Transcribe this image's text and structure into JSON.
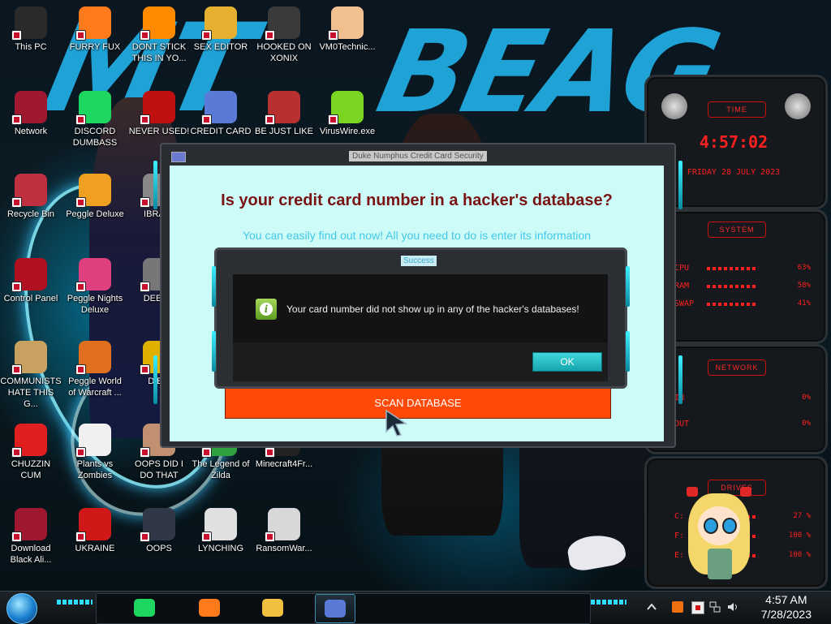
{
  "desktop": {
    "icons": [
      {
        "label": "This PC",
        "icon": "computer-icon",
        "color": "#2a2a2a"
      },
      {
        "label": "FURRY FUX",
        "icon": "firefox-icon",
        "color": "#ff7a1a"
      },
      {
        "label": "DONT STICK\nTHIS IN YO...",
        "icon": "vlc-cone-icon",
        "color": "#ff8a00"
      },
      {
        "label": "SEX EDITOR",
        "icon": "hxd-icon",
        "color": "#e8b030"
      },
      {
        "label": "HOOKED ON\nXONIX",
        "icon": "xonix-icon",
        "color": "#3a3a3a"
      },
      {
        "label": "VM0Technic...",
        "icon": "doctor-icon",
        "color": "#f0c090"
      },
      {
        "label": "Network",
        "icon": "alien-orb-icon",
        "color": "#a01830"
      },
      {
        "label": "DISCORD\nDUMBASS",
        "icon": "spotify-like-icon",
        "color": "#1ed760"
      },
      {
        "label": "NEVER USED!",
        "icon": "dev-cpp-icon",
        "color": "#c01010"
      },
      {
        "label": "CREDIT CARD",
        "icon": "credit-card-icon",
        "color": "#5a7ad8"
      },
      {
        "label": "BE JUST LIKE",
        "icon": "santa-icon",
        "color": "#b83030"
      },
      {
        "label": "VirusWire.exe",
        "icon": "lime-icon",
        "color": "#7ad420"
      },
      {
        "label": "Recycle Bin",
        "icon": "recycle-bin-icon",
        "color": "#c03040"
      },
      {
        "label": "Peggle Deluxe",
        "icon": "peggle-icon",
        "color": "#f0a020"
      },
      {
        "label": "IBRAI...",
        "icon": "robot-icon",
        "color": "#888888"
      },
      {
        "label": "Control Panel",
        "icon": "control-panel-icon",
        "color": "#b01020"
      },
      {
        "label": "Peggle Nights\nDeluxe",
        "icon": "peggle-nights-icon",
        "color": "#e04080"
      },
      {
        "label": "DEEZ...",
        "icon": "printer-icon",
        "color": "#777777"
      },
      {
        "label": "COMMUNISTS\nHATE THIS G...",
        "icon": "money-bag-icon",
        "color": "#c8a060"
      },
      {
        "label": "Peggle World\nof Warcraft ...",
        "icon": "peggle-wow-icon",
        "color": "#e07020"
      },
      {
        "label": "DIE...",
        "icon": "die-icon",
        "color": "#e0b000"
      },
      {
        "label": "CHUZZIN\nCUM",
        "icon": "chuzzle-icon",
        "color": "#e02020"
      },
      {
        "label": "Plants vs\nZombies",
        "icon": "flower-icon",
        "color": "#f0f0f0"
      },
      {
        "label": "OOPS DID I\nDO THAT",
        "icon": "face-icon",
        "color": "#c09070"
      },
      {
        "label": "The Legend of\nZilda",
        "icon": "triforce-icon",
        "color": "#30a040"
      },
      {
        "label": "Minecraft4Fr...",
        "icon": "minecraft-icon",
        "color": "#222222"
      },
      {
        "label": "Download\nBlack Ali...",
        "icon": "alien-orb-icon",
        "color": "#a01830"
      },
      {
        "label": "UKRAINE",
        "icon": "radiation-icon",
        "color": "#d01818"
      },
      {
        "label": "OOPS",
        "icon": "monitor-icon",
        "color": "#303848"
      },
      {
        "label": "LYNCHING",
        "icon": "noose-icon",
        "color": "#e0e0e0"
      },
      {
        "label": "RansomWar...",
        "icon": "skull-icon",
        "color": "#d8d8d8"
      }
    ]
  },
  "widgets": {
    "time": {
      "title": "TIME",
      "clock": "4:57:02",
      "date": "FRIDAY 28 JULY 2023"
    },
    "system": {
      "title": "SYSTEM",
      "rows": [
        {
          "label": "CPU",
          "value": "63%"
        },
        {
          "label": "RAM",
          "value": "58%"
        },
        {
          "label": "SWAP",
          "value": "41%"
        }
      ]
    },
    "network": {
      "title": "NETWORK",
      "rows": [
        {
          "label": "IN",
          "value": "0%"
        },
        {
          "label": "OUT",
          "value": "0%"
        }
      ]
    },
    "drives": {
      "title": "DRIVES",
      "rows": [
        {
          "label": "C:",
          "value": "27 %"
        },
        {
          "label": "F:",
          "value": "100 %"
        },
        {
          "label": "E:",
          "value": "100 %"
        }
      ]
    }
  },
  "app_window": {
    "title": "Duke Numphus Credit Card Security",
    "heading": "Is your credit card number in a hacker's database?",
    "subtext": "You can easily find out now! All you need to do is enter its information",
    "scan_button": "SCAN DATABASE"
  },
  "dialog": {
    "title": "Success",
    "message": "Your card number did not show up in any of the hacker's databases!",
    "ok_button": "OK"
  },
  "taskbar": {
    "apps": [
      {
        "icon": "spotify-like-icon",
        "color": "#1ed760"
      },
      {
        "icon": "firefox-icon",
        "color": "#ff7a1a"
      },
      {
        "icon": "file-explorer-icon",
        "color": "#f0c040"
      },
      {
        "icon": "credit-card-icon",
        "color": "#5a7ad8"
      }
    ],
    "clock_time": "4:57 AM",
    "clock_date": "7/28/2023"
  },
  "colors": {
    "accent_cyan": "#2de0ff",
    "alert_red": "#ff2020",
    "scan_orange": "#ff4a0a",
    "heading_maroon": "#7a1414"
  }
}
